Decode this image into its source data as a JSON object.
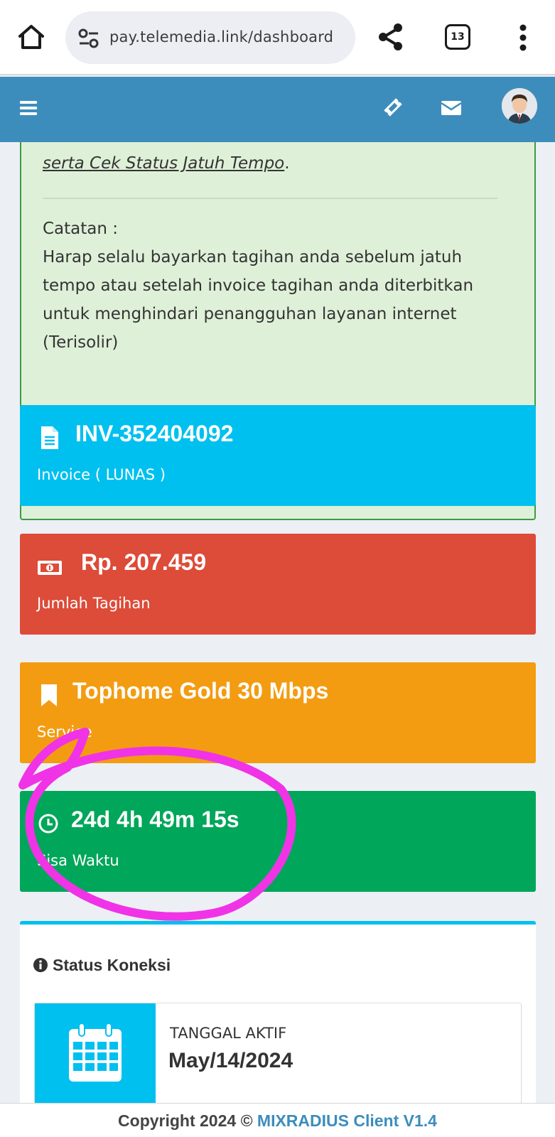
{
  "browser": {
    "url": "pay.telemedia.link/dashboard",
    "tab_count": "13"
  },
  "header": {
    "icons": [
      "menu-icon",
      "ticket-icon",
      "envelope-icon",
      "user-avatar"
    ]
  },
  "callout": {
    "intro_link": "serta Cek Status Jatuh Tempo",
    "intro_suffix": ".",
    "note_title": "Catatan :",
    "note_body": "Harap selalu bayarkan tagihan anda sebelum jatuh tempo atau setelah invoice tagihan anda diterbitkan untuk menghindari penangguhan layanan internet (Terisolir)"
  },
  "boxes": {
    "invoice": {
      "value": "INV-352404092",
      "label": "Invoice ( LUNAS )",
      "icon": "file-text-icon",
      "color": "#00c0ef"
    },
    "amount": {
      "value": "Rp. 207.459",
      "label": "Jumlah Tagihan",
      "icon": "money-bill-icon",
      "color": "#dd4b39"
    },
    "service": {
      "value": "Tophome Gold 30 Mbps",
      "label": "Service",
      "icon": "bookmark-icon",
      "color": "#f39c12"
    },
    "time": {
      "value": "24d 4h 49m 15s",
      "label": "Sisa Waktu",
      "icon": "clock-icon",
      "color": "#00a65a"
    }
  },
  "status_panel": {
    "title": "Status Koneksi",
    "infobox": {
      "label": "TANGGAL AKTIF",
      "value": "May/14/2024",
      "icon": "calendar-icon"
    }
  },
  "footer": {
    "prefix": "Copyright 2024 ©",
    "brand": "MIXRADIUS Client V1.4"
  },
  "colors": {
    "header": "#3c8dbc",
    "annotation": "#f033e6"
  }
}
